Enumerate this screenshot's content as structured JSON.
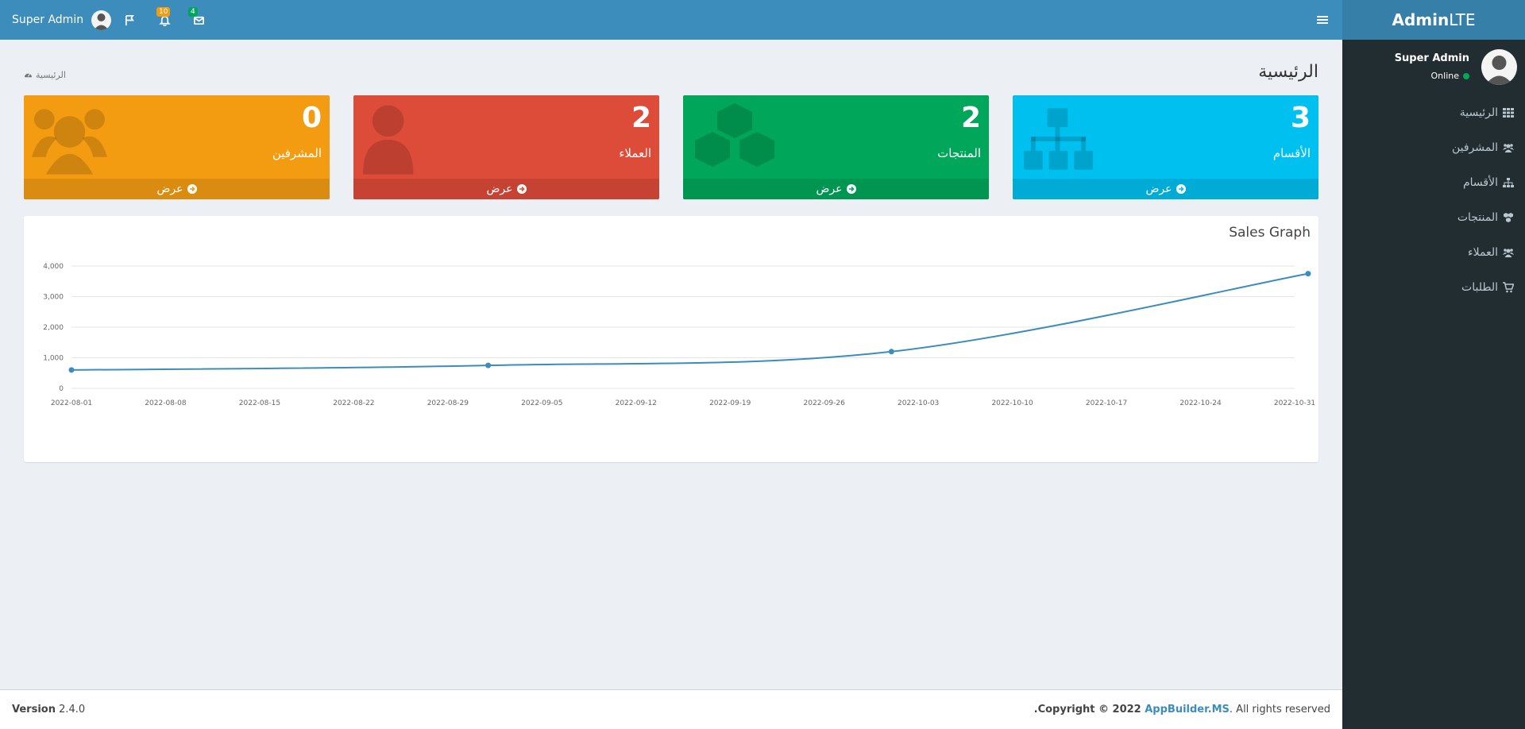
{
  "header": {
    "user_name": "Super Admin",
    "notifications_count": "10",
    "messages_count": "4"
  },
  "sidebar": {
    "logo_bold": "Admin",
    "logo_light": "LTE",
    "user_name": "Super Admin",
    "status": "Online",
    "items": [
      {
        "label": "الرئيسية",
        "icon": "th-icon"
      },
      {
        "label": "المشرفين",
        "icon": "users-icon"
      },
      {
        "label": "الأقسام",
        "icon": "sitemap-icon"
      },
      {
        "label": "المنتجات",
        "icon": "cubes-icon"
      },
      {
        "label": "العملاء",
        "icon": "users-icon"
      },
      {
        "label": "الطلبات",
        "icon": "cart-icon"
      }
    ]
  },
  "page": {
    "title": "الرئيسية",
    "breadcrumb": "الرئيسية"
  },
  "boxes": [
    {
      "value": "3",
      "label": "الأقسام",
      "footer": "عرض",
      "color": "#00c0ef",
      "icon": "sitemap-icon"
    },
    {
      "value": "2",
      "label": "المنتجات",
      "footer": "عرض",
      "color": "#00a65a",
      "icon": "cubes-icon"
    },
    {
      "value": "2",
      "label": "العملاء",
      "footer": "عرض",
      "color": "#dd4b39",
      "icon": "user-icon"
    },
    {
      "value": "0",
      "label": "المشرفين",
      "footer": "عرض",
      "color": "#f39c12",
      "icon": "users-icon"
    }
  ],
  "chart_data": {
    "type": "line",
    "title": "Sales Graph",
    "x": [
      "2022-08-01",
      "2022-09-01",
      "2022-10-01",
      "2022-11-01"
    ],
    "series": [
      {
        "values": [
          600,
          750,
          1200,
          3750
        ]
      }
    ],
    "ylim": [
      0,
      4000
    ],
    "yticks": [
      "0",
      "1,000",
      "2,000",
      "3,000",
      "4,000"
    ],
    "xticks": [
      "2022-08-01",
      "2022-08-08",
      "2022-08-15",
      "2022-08-22",
      "2022-08-29",
      "2022-09-05",
      "2022-09-12",
      "2022-09-19",
      "2022-09-26",
      "2022-10-03",
      "2022-10-10",
      "2022-10-17",
      "2022-10-24",
      "2022-10-31"
    ],
    "grid": true,
    "color": "#3c8dbc"
  },
  "footer": {
    "version_label": "Version",
    "version": "2.4.0",
    "copyright_prefix": ".Copyright © 2022 ",
    "brand": "AppBuilder.MS",
    "copyright_suffix": ". All rights reserved"
  }
}
